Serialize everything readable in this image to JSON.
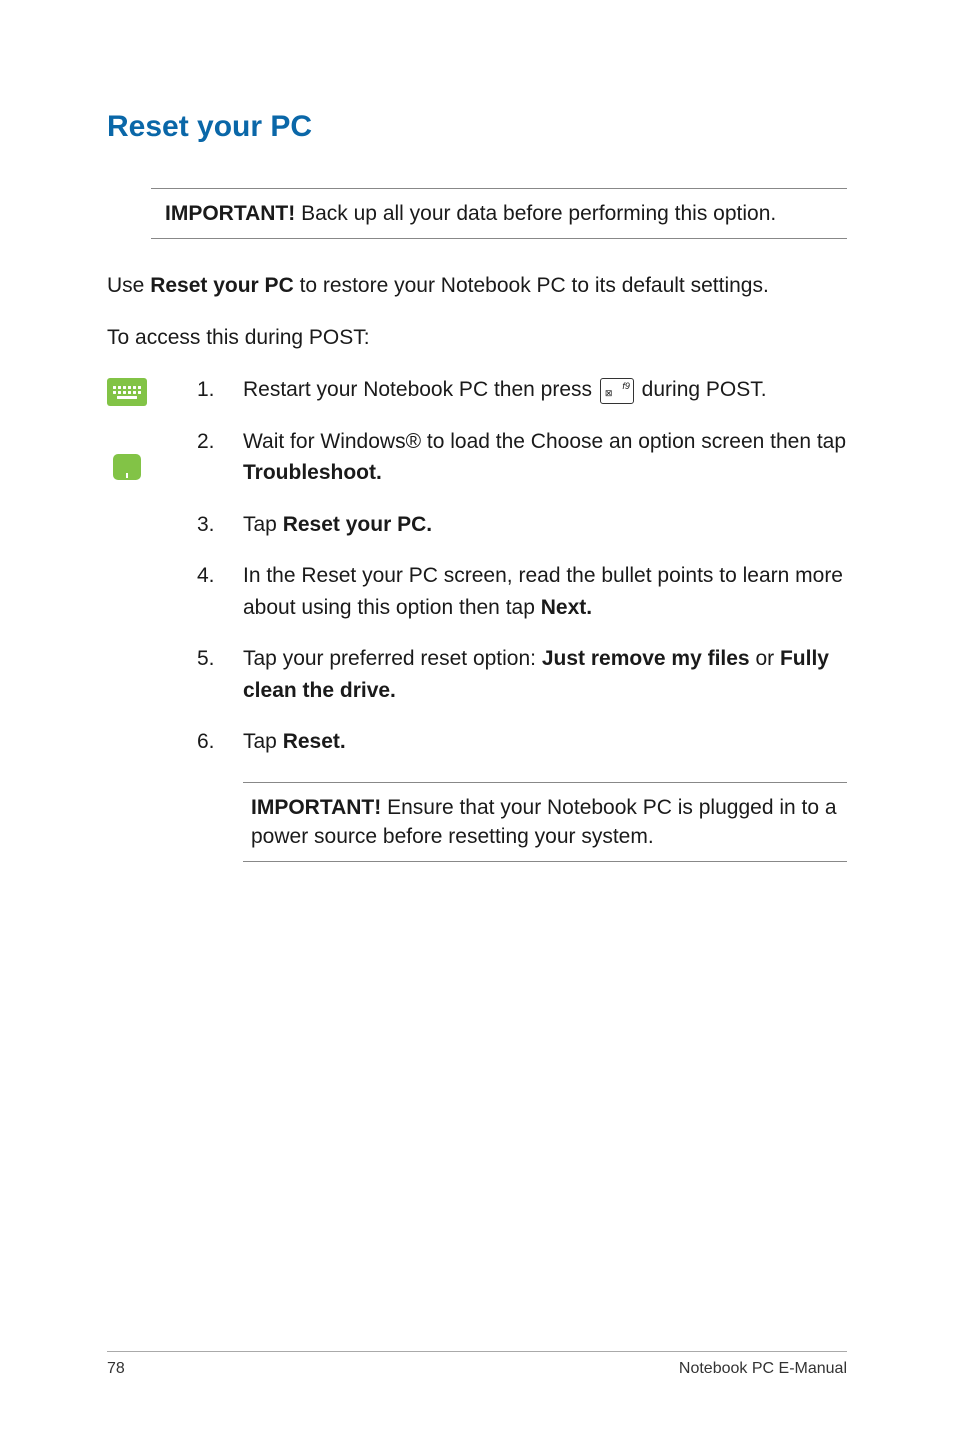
{
  "title": "Reset your PC",
  "topCallout": {
    "boldLabel": "IMPORTANT!",
    "text": " Back up all your data before performing this option."
  },
  "intro": {
    "pre": "Use ",
    "bold": "Reset your PC",
    "post": " to restore your Notebook PC to its default settings."
  },
  "accessLine": "To access this during POST:",
  "steps": [
    {
      "num": "1.",
      "pre": "Restart your Notebook PC then press ",
      "keySub": "⊠",
      "keySup": "f9",
      "post": " during POST."
    },
    {
      "num": "2.",
      "pre": "Wait for Windows® to load the Choose an option screen then tap ",
      "bold": "Troubleshoot."
    },
    {
      "num": "3.",
      "pre": "Tap ",
      "bold": "Reset your PC."
    },
    {
      "num": "4.",
      "pre": "In the Reset your PC screen, read the bullet points to learn more about using this option then tap ",
      "bold": "Next."
    },
    {
      "num": "5.",
      "pre": "Tap your preferred reset option: ",
      "bold": "Just remove my files",
      "mid": " or ",
      "bold2": "Fully clean the drive."
    },
    {
      "num": "6.",
      "pre": "Tap ",
      "bold": "Reset."
    }
  ],
  "bottomCallout": {
    "boldLabel": "IMPORTANT!",
    "text": " Ensure that your Notebook PC is plugged in to a power source before resetting your system."
  },
  "footer": {
    "pageNum": "78",
    "docTitle": "Notebook PC E-Manual"
  }
}
